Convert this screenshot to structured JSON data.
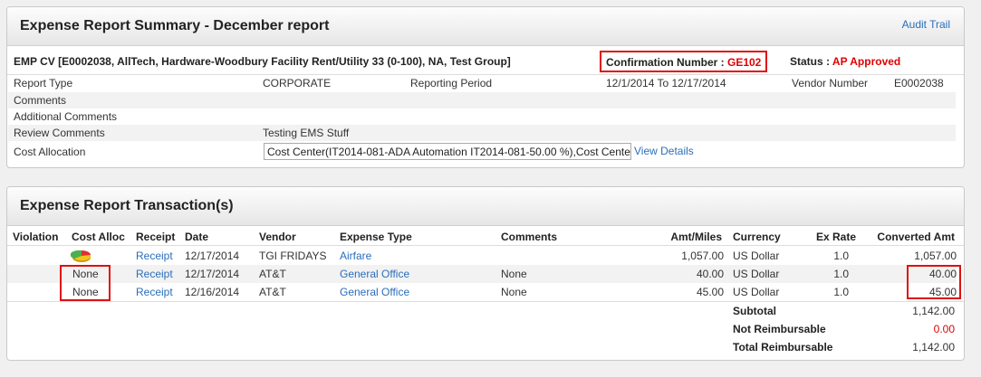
{
  "summary": {
    "title": "Expense Report Summary - December report",
    "audit_trail": "Audit Trail",
    "employee": "EMP CV [E0002038, AllTech, Hardware-Woodbury Facility Rent/Utility 33 (0-100), NA, Test Group]",
    "confirmation_label": "Confirmation Number : ",
    "confirmation_value": "GE102",
    "status_label": "Status : ",
    "status_value": "AP Approved",
    "report_type_label": "Report Type",
    "report_type_value": "CORPORATE",
    "reporting_period_label": "Reporting Period",
    "reporting_period_value": "12/1/2014 To 12/17/2014",
    "vendor_number_label": "Vendor Number",
    "vendor_number_value": "E0002038",
    "comments_label": "Comments",
    "additional_comments_label": "Additional Comments",
    "review_comments_label": "Review Comments",
    "review_comments_value": "Testing EMS Stuff",
    "cost_allocation_label": "Cost Allocation",
    "cost_allocation_value": "Cost Center(IT2014-081-ADA Automation IT2014-081-50.00 %),Cost Center",
    "view_details": "View Details"
  },
  "transactions": {
    "title": "Expense Report Transaction(s)",
    "headers": {
      "violation": "Violation",
      "cost_alloc": "Cost Alloc",
      "receipt": "Receipt",
      "date": "Date",
      "vendor": "Vendor",
      "expense_type": "Expense Type",
      "comments": "Comments",
      "amt": "Amt/Miles",
      "currency": "Currency",
      "ex_rate": "Ex Rate",
      "converted": "Converted Amt"
    },
    "rows": [
      {
        "cost_alloc": "",
        "cost_alloc_icon": "pie-chart-icon",
        "receipt": "Receipt",
        "date": "12/17/2014",
        "vendor": "TGI FRIDAYS",
        "expense_type": "Airfare",
        "comments": "",
        "amt": "1,057.00",
        "currency": "US Dollar",
        "ex_rate": "1.0",
        "converted": "1,057.00"
      },
      {
        "cost_alloc": "None",
        "receipt": "Receipt",
        "date": "12/17/2014",
        "vendor": "AT&T",
        "expense_type": "General Office",
        "comments": "None",
        "amt": "40.00",
        "currency": "US Dollar",
        "ex_rate": "1.0",
        "converted": "40.00"
      },
      {
        "cost_alloc": "None",
        "receipt": "Receipt",
        "date": "12/16/2014",
        "vendor": "AT&T",
        "expense_type": "General Office",
        "comments": "None",
        "amt": "45.00",
        "currency": "US Dollar",
        "ex_rate": "1.0",
        "converted": "45.00"
      }
    ],
    "subtotal_label": "Subtotal",
    "subtotal_value": "1,142.00",
    "not_reimbursable_label": "Not Reimbursable",
    "not_reimbursable_value": "0.00",
    "total_reimbursable_label": "Total Reimbursable",
    "total_reimbursable_value": "1,142.00"
  },
  "colors": {
    "highlight_box": "#e01010",
    "link": "#2a6ebb",
    "status_red": "#e00000"
  }
}
